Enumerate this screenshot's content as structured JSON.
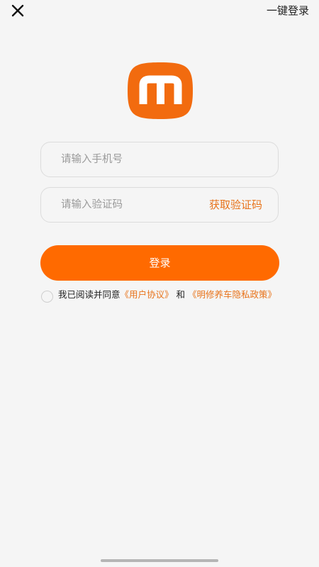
{
  "header": {
    "close_icon": "close-icon",
    "one_click_login_label": "一键登录"
  },
  "logo": {
    "icon": "app-logo-m",
    "letter": "m",
    "bg_color": "#f26b0f",
    "fg_color": "#ffffff"
  },
  "form": {
    "phone_placeholder": "请输入手机号",
    "phone_value": "",
    "code_placeholder": "请输入验证码",
    "code_value": "",
    "get_code_label": "获取验证码",
    "login_label": "登录"
  },
  "agreement": {
    "checked": false,
    "prefix": "我已阅读并同意",
    "user_agreement_link": "《用户协议》",
    "conjunction": "和",
    "privacy_policy_link": "《明修养车隐私政策》"
  },
  "colors": {
    "accent": "#ff6a00",
    "link": "#e8731a",
    "background": "#f5f5f5"
  }
}
